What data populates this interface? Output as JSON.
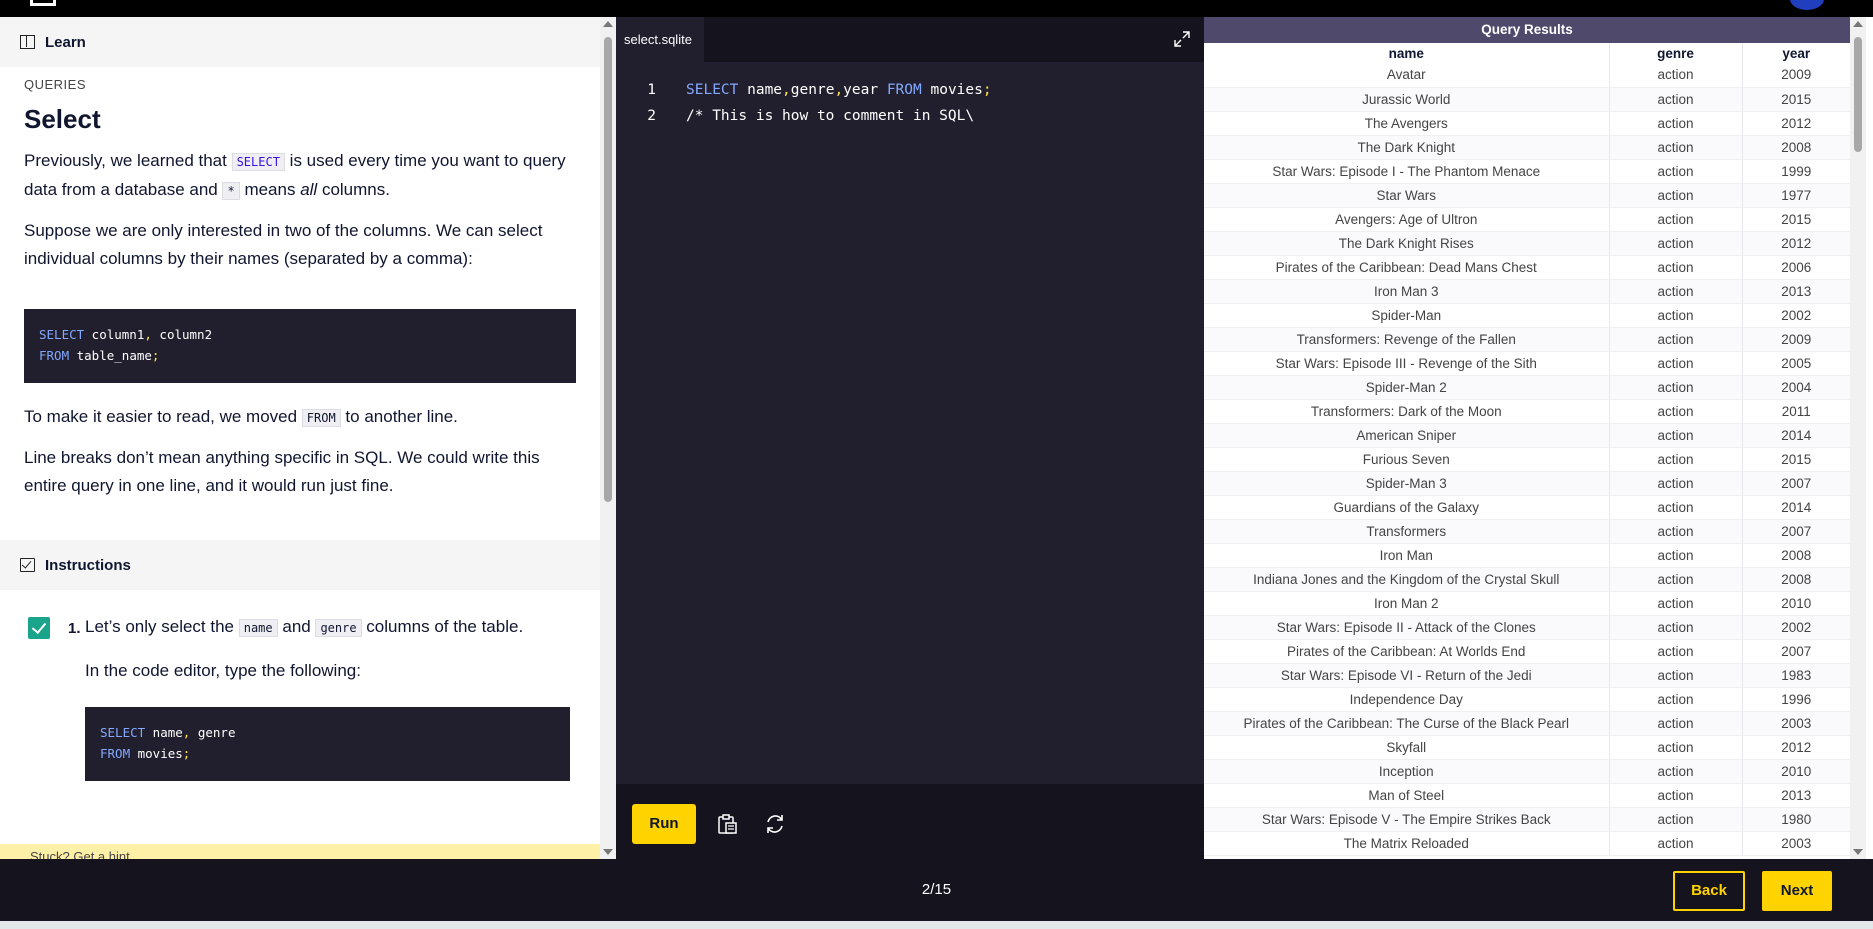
{
  "lesson": {
    "learn_label": "Learn",
    "eyebrow": "QUERIES",
    "title": "Select",
    "p1_a": "Previously, we learned that ",
    "p1_code1": "SELECT",
    "p1_b": " is used every time you want to query data from a database and ",
    "p1_code2": "*",
    "p1_c": " means ",
    "p1_em": "all",
    "p1_d": " columns.",
    "p2": "Suppose we are only interested in two of the columns. We can select individual columns by their names (separated by a comma):",
    "code1_kw1": "SELECT",
    "code1_cols": " column1",
    "code1_comma": ",",
    "code1_col2": " column2",
    "code1_kw2": "FROM",
    "code1_tbl": " table_name",
    "code1_semi": ";",
    "p3_a": "To make it easier to read, we moved ",
    "p3_code": "FROM",
    "p3_b": " to another line.",
    "p4": "Line breaks don’t mean anything specific in SQL. We could write this entire query in one line, and it would run just fine.",
    "instructions_label": "Instructions",
    "instr_num": "1.",
    "instr_a": "Let’s only select the ",
    "instr_code1": "name",
    "instr_b": " and ",
    "instr_code2": "genre",
    "instr_c": " columns of the table.",
    "instr_sub": "In the code editor, type the following:",
    "code2_kw1": "SELECT",
    "code2_cols": " name",
    "code2_comma": ",",
    "code2_col2": " genre",
    "code2_kw2": "FROM",
    "code2_tbl": " movies",
    "code2_semi": ";",
    "hint": "Stuck? Get a hint"
  },
  "editor": {
    "tab": "select.sqlite",
    "lines": [
      {
        "n": "1",
        "kw1": "SELECT",
        "a": " name",
        "c1": ",",
        "b": "genre",
        "c2": ",",
        "c": "year ",
        "kw2": "FROM",
        "d": " movies",
        "semi": ";"
      },
      {
        "n": "2",
        "comment": "/* This is how to comment in SQL\\"
      }
    ],
    "run_label": "Run"
  },
  "results": {
    "title": "Query Results",
    "headers": [
      "name",
      "genre",
      "year"
    ],
    "rows": [
      [
        "Avatar",
        "action",
        "2009"
      ],
      [
        "Jurassic World",
        "action",
        "2015"
      ],
      [
        "The Avengers",
        "action",
        "2012"
      ],
      [
        "The Dark Knight",
        "action",
        "2008"
      ],
      [
        "Star Wars: Episode I - The Phantom Menace",
        "action",
        "1999"
      ],
      [
        "Star Wars",
        "action",
        "1977"
      ],
      [
        "Avengers: Age of Ultron",
        "action",
        "2015"
      ],
      [
        "The Dark Knight Rises",
        "action",
        "2012"
      ],
      [
        "Pirates of the Caribbean: Dead Mans Chest",
        "action",
        "2006"
      ],
      [
        "Iron Man 3",
        "action",
        "2013"
      ],
      [
        "Spider-Man",
        "action",
        "2002"
      ],
      [
        "Transformers: Revenge of the Fallen",
        "action",
        "2009"
      ],
      [
        "Star Wars: Episode III - Revenge of the Sith",
        "action",
        "2005"
      ],
      [
        "Spider-Man 2",
        "action",
        "2004"
      ],
      [
        "Transformers: Dark of the Moon",
        "action",
        "2011"
      ],
      [
        "American Sniper",
        "action",
        "2014"
      ],
      [
        "Furious Seven",
        "action",
        "2015"
      ],
      [
        "Spider-Man 3",
        "action",
        "2007"
      ],
      [
        "Guardians of the Galaxy",
        "action",
        "2014"
      ],
      [
        "Transformers",
        "action",
        "2007"
      ],
      [
        "Iron Man",
        "action",
        "2008"
      ],
      [
        "Indiana Jones and the Kingdom of the Crystal Skull",
        "action",
        "2008"
      ],
      [
        "Iron Man 2",
        "action",
        "2010"
      ],
      [
        "Star Wars: Episode II - Attack of the Clones",
        "action",
        "2002"
      ],
      [
        "Pirates of the Caribbean: At Worlds End",
        "action",
        "2007"
      ],
      [
        "Star Wars: Episode VI - Return of the Jedi",
        "action",
        "1983"
      ],
      [
        "Independence Day",
        "action",
        "1996"
      ],
      [
        "Pirates of the Caribbean: The Curse of the Black Pearl",
        "action",
        "2003"
      ],
      [
        "Skyfall",
        "action",
        "2012"
      ],
      [
        "Inception",
        "action",
        "2010"
      ],
      [
        "Man of Steel",
        "action",
        "2013"
      ],
      [
        "Star Wars: Episode V - The Empire Strikes Back",
        "action",
        "1980"
      ],
      [
        "The Matrix Reloaded",
        "action",
        "2003"
      ]
    ]
  },
  "footer": {
    "pager": "2/15",
    "back_label": "Back",
    "next_label": "Next"
  },
  "colors": {
    "accent": "#ffd300",
    "editor_bg": "#211f2d",
    "results_header": "#4f4a6b",
    "check": "#19a48b"
  }
}
